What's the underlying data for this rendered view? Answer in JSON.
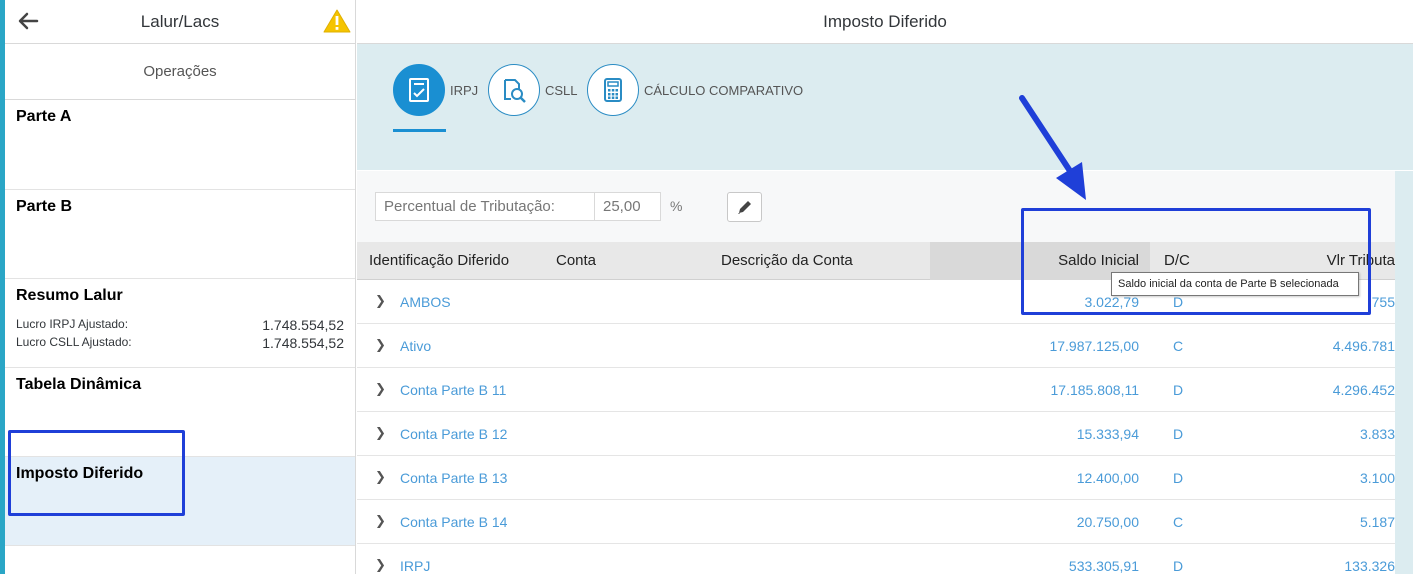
{
  "left_panel": {
    "title": "Lalur/Lacs",
    "operations_label": "Operações",
    "nav": {
      "parte_a": "Parte A",
      "parte_b": "Parte B",
      "resumo_lalur": "Resumo Lalur",
      "tabela_dinamica": "Tabela Dinâmica",
      "imposto_diferido": "Imposto Diferido"
    },
    "resumo": {
      "irpj_label": "Lucro IRPJ Ajustado:",
      "irpj_value": "1.748.554,52",
      "csll_label": "Lucro CSLL Ajustado:",
      "csll_value": "1.748.554,52"
    }
  },
  "main": {
    "title": "Imposto Diferido",
    "tabs": [
      {
        "label": "IRPJ",
        "icon": "document-check-icon",
        "active": true
      },
      {
        "label": "CSLL",
        "icon": "document-search-icon",
        "active": false
      },
      {
        "label": "CÁLCULO COMPARATIVO",
        "icon": "calculator-icon",
        "active": false
      }
    ],
    "toolbar": {
      "percent_label": "Percentual de Tributação:",
      "percent_value": "25,00",
      "percent_unit": "%"
    },
    "table": {
      "headers": {
        "identificacao": "Identificação Diferido",
        "conta": "Conta",
        "descricao": "Descrição da Conta",
        "saldo": "Saldo Inicial",
        "dc": "D/C",
        "vlr": "Vlr Tributa"
      },
      "rows": [
        {
          "ident": "AMBOS",
          "saldo": "3.022,79",
          "dc": "D",
          "vlr": "755"
        },
        {
          "ident": "Ativo",
          "saldo": "17.987.125,00",
          "dc": "C",
          "vlr": "4.496.781"
        },
        {
          "ident": "Conta Parte B 11",
          "saldo": "17.185.808,11",
          "dc": "D",
          "vlr": "4.296.452"
        },
        {
          "ident": "Conta Parte B 12",
          "saldo": "15.333,94",
          "dc": "D",
          "vlr": "3.833"
        },
        {
          "ident": "Conta Parte B 13",
          "saldo": "12.400,00",
          "dc": "D",
          "vlr": "3.100"
        },
        {
          "ident": "Conta Parte B 14",
          "saldo": "20.750,00",
          "dc": "C",
          "vlr": "5.187"
        },
        {
          "ident": "IRPJ",
          "saldo": "533.305,91",
          "dc": "D",
          "vlr": "133.326"
        }
      ]
    },
    "tooltip": "Saldo inicial da conta de Parte B selecionada"
  },
  "colors": {
    "accent": "#1a8fd2",
    "link": "#4a9bd8",
    "highlight": "#1f3fd8",
    "tabbar_bg": "#dcecf0",
    "warning": "#f5c400"
  }
}
